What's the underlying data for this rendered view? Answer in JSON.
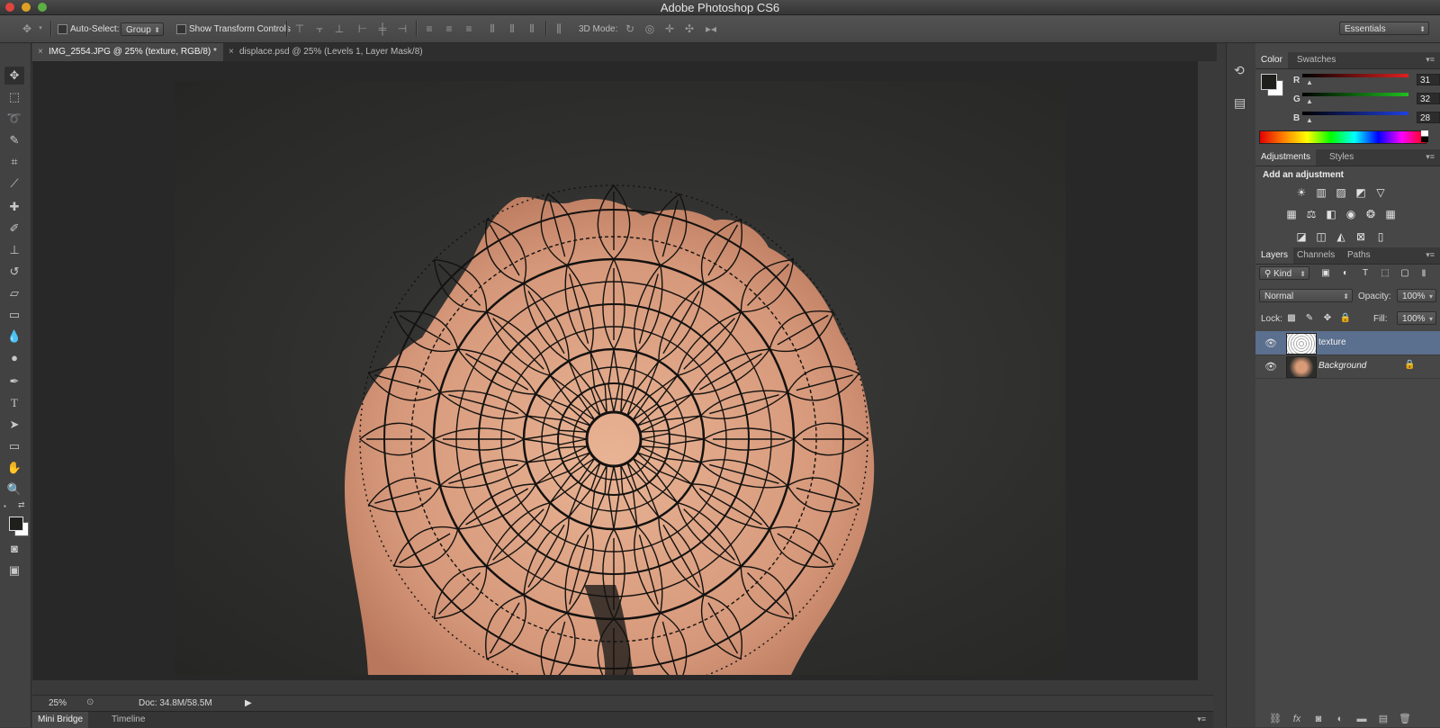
{
  "window": {
    "title": "Adobe Photoshop CS6",
    "workspace": "Essentials"
  },
  "options_bar": {
    "auto_select_label": "Auto-Select:",
    "auto_select_value": "Group",
    "transform_label": "Show Transform Controls",
    "mode_3d_label": "3D Mode:"
  },
  "tabs": [
    {
      "label": "IMG_2554.JPG @ 25% (texture, RGB/8) *",
      "active": true
    },
    {
      "label": "displace.psd @ 25% (Levels 1, Layer Mask/8)",
      "active": false
    }
  ],
  "status": {
    "zoom": "25%",
    "doc": "Doc: 34.8M/58.5M"
  },
  "bottom_tabs": [
    "Mini Bridge",
    "Timeline"
  ],
  "color_panel": {
    "tabs": [
      "Color",
      "Swatches"
    ],
    "channels": [
      {
        "name": "R",
        "value": "31",
        "color": "#e04040"
      },
      {
        "name": "G",
        "value": "32",
        "color": "#40c040"
      },
      {
        "name": "B",
        "value": "28",
        "color": "#4060e0"
      }
    ]
  },
  "adjustments_panel": {
    "tabs": [
      "Adjustments",
      "Styles"
    ],
    "heading": "Add an adjustment"
  },
  "layers_panel": {
    "tabs": [
      "Layers",
      "Channels",
      "Paths"
    ],
    "filter_kind": "Kind",
    "blend_mode": "Normal",
    "opacity_label": "Opacity:",
    "opacity_value": "100%",
    "lock_label": "Lock:",
    "fill_label": "Fill:",
    "fill_value": "100%",
    "layers": [
      {
        "name": "texture",
        "selected": true
      },
      {
        "name": "Background",
        "selected": false,
        "locked": true
      }
    ]
  },
  "colors": {
    "accent_selected_layer": "#5b6f8e",
    "canvas_bg": "#282828"
  }
}
